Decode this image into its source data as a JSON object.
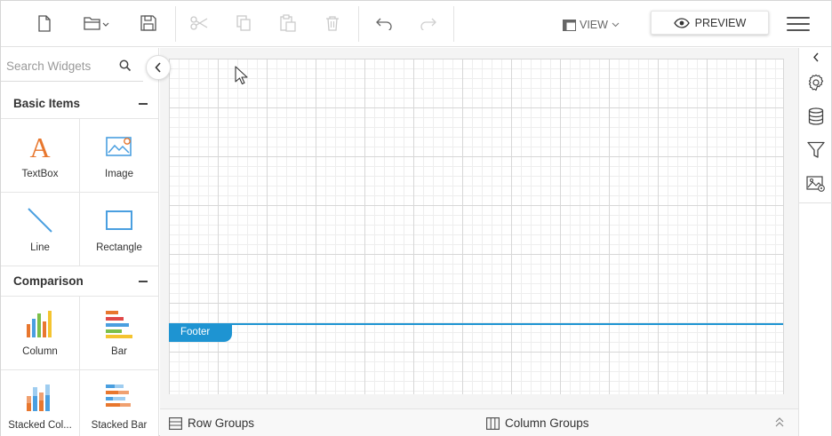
{
  "toolbar": {
    "icons": [
      "new-file-icon",
      "open-folder-icon",
      "save-icon",
      "cut-icon",
      "copy-icon",
      "paste-icon",
      "delete-icon",
      "undo-icon",
      "redo-icon"
    ],
    "view_label": "VIEW",
    "preview_label": "PREVIEW"
  },
  "search": {
    "placeholder": "Search Widgets",
    "value": ""
  },
  "sections": [
    {
      "title": "Basic Items",
      "items": [
        {
          "label": "TextBox",
          "icon": "textbox-icon"
        },
        {
          "label": "Image",
          "icon": "image-icon"
        },
        {
          "label": "Line",
          "icon": "line-icon"
        },
        {
          "label": "Rectangle",
          "icon": "rectangle-icon"
        }
      ]
    },
    {
      "title": "Comparison",
      "items": [
        {
          "label": "Column",
          "icon": "column-chart-icon"
        },
        {
          "label": "Bar",
          "icon": "bar-chart-icon"
        },
        {
          "label": "Stacked Col...",
          "icon": "stacked-column-chart-icon"
        },
        {
          "label": "Stacked Bar",
          "icon": "stacked-bar-chart-icon"
        }
      ]
    }
  ],
  "design": {
    "footer_label": "Footer"
  },
  "bottom_bar": {
    "row_groups": "Row Groups",
    "column_groups": "Column Groups"
  },
  "right_panel": {
    "icons": [
      "collapse-right-icon",
      "settings-icon",
      "data-source-icon",
      "filter-icon",
      "image-settings-icon"
    ]
  },
  "colors": {
    "accent": "#1e94d2",
    "textbox_orange": "#e8772e",
    "image_blue": "#4a9fe0"
  }
}
